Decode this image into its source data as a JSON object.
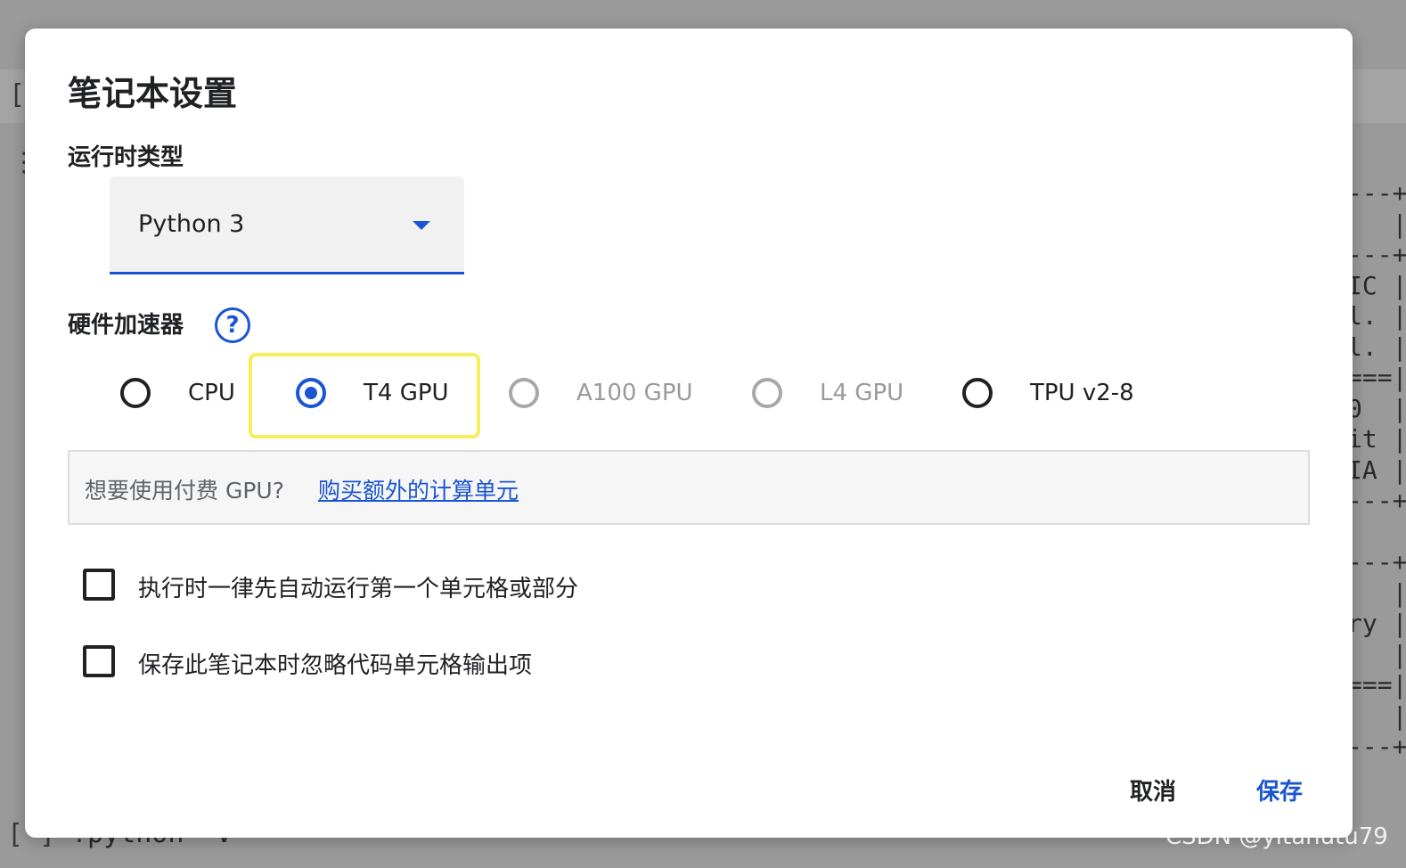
{
  "background": {
    "bracket_top": "[",
    "icon_left": "⋮",
    "bracket_bottom": "[ ]",
    "code_line": "!python -V",
    "terminal_lines": "---+\n   |\n---+\nIC |\nl. |\nl. |\n===|\n0  |\nit |\nIA |\n---+\n\n---+\n   |\nry |\n   |\n===|\n   |\n---+"
  },
  "dialog": {
    "title": "笔记本设置",
    "runtime_type": {
      "label": "运行时类型",
      "selected": "Python 3"
    },
    "hardware_accelerator": {
      "label": "硬件加速器",
      "help_icon": "?",
      "options": [
        {
          "label": "CPU",
          "state": "unselected"
        },
        {
          "label": "T4 GPU",
          "state": "selected"
        },
        {
          "label": "A100 GPU",
          "state": "disabled"
        },
        {
          "label": "L4 GPU",
          "state": "disabled"
        },
        {
          "label": "TPU v2-8",
          "state": "unselected"
        }
      ]
    },
    "info": {
      "text": "想要使用付费 GPU?",
      "link": "购买额外的计算单元"
    },
    "checkboxes": [
      {
        "label": "执行时一律先自动运行第一个单元格或部分",
        "checked": false
      },
      {
        "label": "保存此笔记本时忽略代码单元格输出项",
        "checked": false
      }
    ],
    "buttons": {
      "cancel": "取消",
      "save": "保存"
    },
    "colors": {
      "accent": "#1a55d3",
      "highlight": "#f7ee5c"
    }
  },
  "watermark": "CSDN @yitahutu79"
}
